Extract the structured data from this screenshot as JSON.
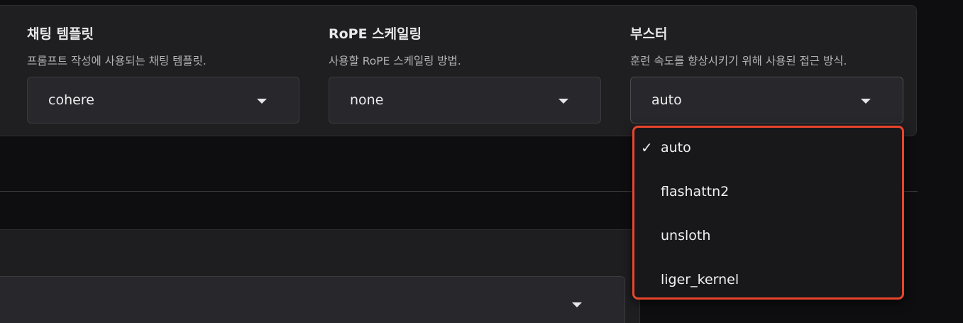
{
  "fields": [
    {
      "label": "채팅 템플릿",
      "description": "프롬프트 작성에 사용되는 채팅 템플릿.",
      "value": "cohere"
    },
    {
      "label": "RoPE 스케일링",
      "description": "사용할 RoPE 스케일링 방법.",
      "value": "none"
    },
    {
      "label": "부스터",
      "description": "훈련 속도를 향상시키기 위해 사용된 접근 방식.",
      "value": "auto"
    }
  ],
  "dropdown": {
    "check_mark": "✓",
    "selected": "auto",
    "options": [
      "auto",
      "flashattn2",
      "unsloth",
      "liger_kernel"
    ]
  },
  "colors": {
    "highlight_border": "#e8452c",
    "background": "#0e0e10",
    "panel": "#1f1f22"
  }
}
